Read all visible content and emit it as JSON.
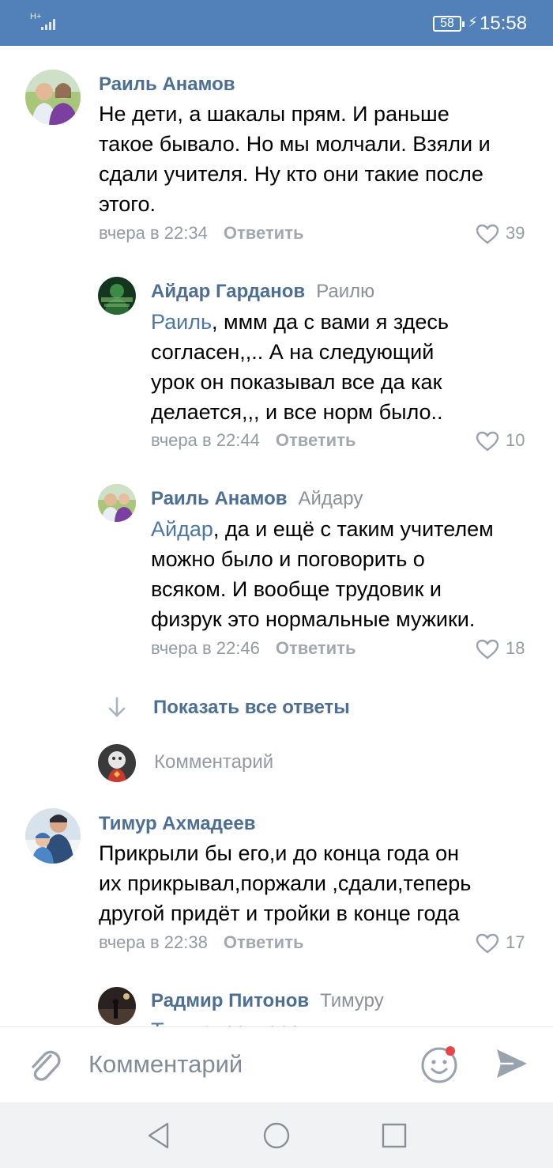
{
  "status_bar": {
    "network": "H+",
    "battery": "58",
    "time": "15:58"
  },
  "comments": [
    {
      "author": "Раиль Анамов",
      "lines": [
        "Не дети, а шакалы прям. И раньше",
        "такое бывало. Но мы молчали. Взяли и",
        "сдали учителя. Ну кто они такие после",
        "этого."
      ],
      "time": "вчера в 22:34",
      "reply_label": "Ответить",
      "likes": "39"
    },
    {
      "author": "Айдар Гарданов",
      "reply_to": "Раилю",
      "mention": "Раиль",
      "first_line_rest": ", ммм да с вами я здесь",
      "lines": [
        "согласен,,.. А на следующий",
        "урок он показывал все да как",
        "делается,,, и все норм было.."
      ],
      "time": "вчера в 22:44",
      "reply_label": "Ответить",
      "likes": "10"
    },
    {
      "author": "Раиль Анамов",
      "reply_to": "Айдару",
      "mention": "Айдар",
      "first_line_rest": ", да и ещё с таким учителем",
      "lines": [
        "можно было и поговорить о",
        "всяком. И вообще трудовик и",
        "физрук это нормальные мужики."
      ],
      "time": "вчера в 22:46",
      "reply_label": "Ответить",
      "likes": "18"
    },
    {
      "author": "Тимур Ахмадеев",
      "lines": [
        "Прикрыли бы его,и до конца года он",
        "их прикрывал,поржали ,сдали,теперь",
        "другой придёт и тройки в конце года"
      ],
      "time": "вчера в 22:38",
      "reply_label": "Ответить",
      "likes": "17"
    },
    {
      "author": "Радмир Питонов",
      "reply_to": "Тимуру",
      "mention": "Тимур",
      "first_line_rest": ", согласен"
    }
  ],
  "show_all_replies": "Показать все ответы",
  "comment_prompt": "Комментарий",
  "composer": {
    "placeholder": "Комментарий"
  },
  "colors": {
    "brand": "#5181b8",
    "author": "#4d6f93",
    "meta": "#939aa2",
    "notification_dot": "#e64646"
  }
}
